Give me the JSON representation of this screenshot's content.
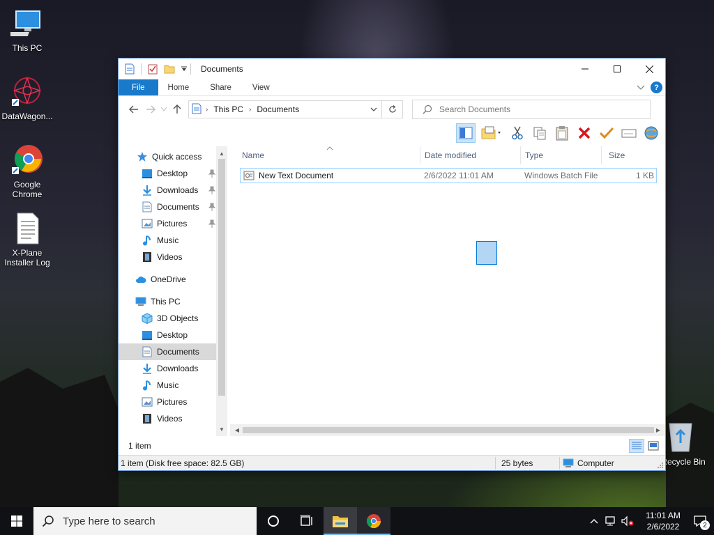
{
  "desktop": {
    "icons": [
      {
        "label": "This PC"
      },
      {
        "label": "DataWagon..."
      },
      {
        "label": "Google Chrome"
      },
      {
        "label": "X-Plane Installer Log"
      },
      {
        "label": "Recycle Bin"
      }
    ]
  },
  "window": {
    "title": "Documents",
    "ribbon_tabs": [
      "File",
      "Home",
      "Share",
      "View"
    ],
    "address": {
      "crumbs": [
        "This PC",
        "Documents"
      ]
    },
    "search_placeholder": "Search Documents",
    "nav": {
      "quick_access": "Quick access",
      "quick_items": [
        "Desktop",
        "Downloads",
        "Documents",
        "Pictures",
        "Music",
        "Videos"
      ],
      "onedrive": "OneDrive",
      "this_pc": "This PC",
      "pc_items": [
        "3D Objects",
        "Desktop",
        "Documents",
        "Downloads",
        "Music",
        "Pictures",
        "Videos"
      ],
      "selected": "Documents"
    },
    "columns": {
      "name": "Name",
      "date": "Date modified",
      "type": "Type",
      "size": "Size"
    },
    "files": [
      {
        "name": "New Text Document",
        "date": "2/6/2022 11:01 AM",
        "type": "Windows Batch File",
        "size": "1 KB"
      }
    ],
    "item_count": "1 item",
    "status": {
      "disk": "1 item (Disk free space: 82.5 GB)",
      "bytes": "25 bytes",
      "location": "Computer"
    }
  },
  "taskbar": {
    "search_placeholder": "Type here to search",
    "time": "11:01 AM",
    "date": "2/6/2022",
    "notifications": "2"
  },
  "colors": {
    "accent": "#1979ca",
    "selection_border": "#99d1ff",
    "taskbar": "#101114"
  }
}
